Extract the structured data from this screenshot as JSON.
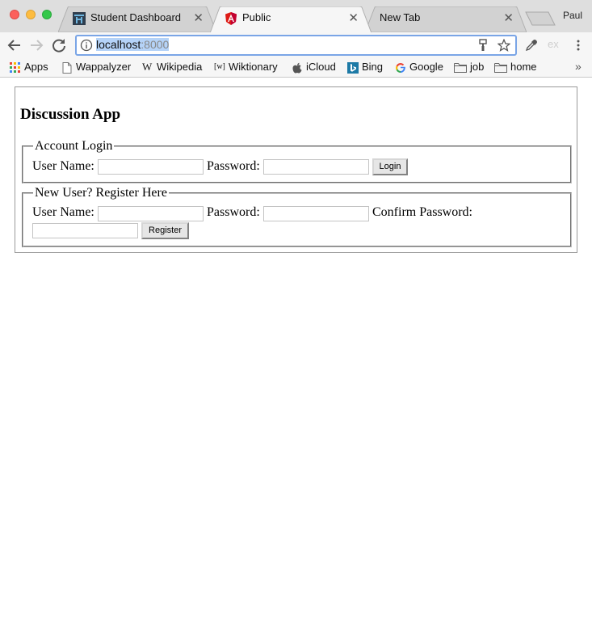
{
  "browser": {
    "tabs": [
      {
        "title": "Student Dashboard",
        "icon": "student-dashboard-favicon",
        "active": false
      },
      {
        "title": "Public",
        "icon": "angular-favicon",
        "active": true
      },
      {
        "title": "New Tab",
        "icon": "",
        "active": false
      }
    ],
    "profile": "Paul",
    "url_host": "localhost",
    "url_port": ":8000",
    "ext_label": "ex",
    "bookmarks": [
      {
        "label": "Apps",
        "icon": "apps-grid-icon"
      },
      {
        "label": "Wappalyzer",
        "icon": "page-icon"
      },
      {
        "label": "Wikipedia",
        "icon": "wikipedia-icon"
      },
      {
        "label": "Wiktionary",
        "icon": "wiktionary-icon"
      },
      {
        "label": "iCloud",
        "icon": "apple-icon"
      },
      {
        "label": "Bing",
        "icon": "bing-icon"
      },
      {
        "label": "Google",
        "icon": "google-icon"
      },
      {
        "label": "job",
        "icon": "folder-icon"
      },
      {
        "label": "home",
        "icon": "folder-icon"
      }
    ],
    "bookmarks_more": "»"
  },
  "app": {
    "title": "Discussion App",
    "login": {
      "legend": "Account Login",
      "username_label": "User Name:",
      "password_label": "Password:",
      "username_value": "",
      "password_value": "",
      "submit_label": "Login"
    },
    "register": {
      "legend": "New User? Register Here",
      "username_label": "User Name:",
      "password_label": "Password:",
      "confirm_label": "Confirm Password:",
      "username_value": "",
      "password_value": "",
      "confirm_value": "",
      "submit_label": "Register"
    }
  },
  "colors": {
    "tabstrip": "#dedede",
    "toolbar": "#f6f6f6",
    "omnibox_focus": "#7aa5e6",
    "url_selection": "#b5d3f8",
    "angular_red": "#dd1b16"
  }
}
